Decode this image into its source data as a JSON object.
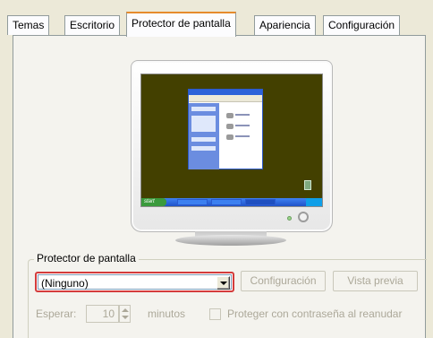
{
  "tabs": [
    {
      "label": "Temas"
    },
    {
      "label": "Escritorio"
    },
    {
      "label": "Protector de pantalla",
      "active": true
    },
    {
      "label": "Apariencia"
    },
    {
      "label": "Configuración"
    }
  ],
  "preview": {
    "mini_taskbar_start": "start"
  },
  "screensaver_group": {
    "label": "Protector de pantalla",
    "selected": "(Ninguno)",
    "settings_button": "Configuración",
    "preview_button": "Vista previa",
    "wait_label": "Esperar:",
    "wait_value": "10",
    "minutes_label": "minutos",
    "password_checkbox_label": "Proteger con contraseña al reanudar",
    "password_checked": false
  },
  "colors": {
    "highlight": "#d43c3c",
    "screen_background": "#434000",
    "active_tab_accent": "#e68b2c"
  }
}
